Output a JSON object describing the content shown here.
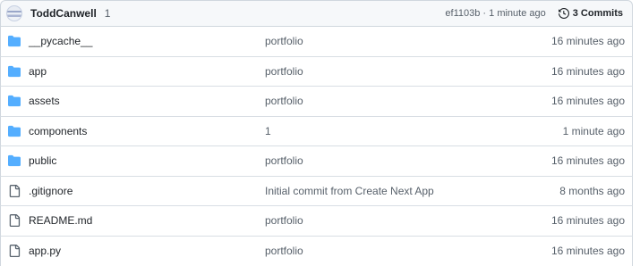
{
  "commit": {
    "author": "ToddCanwell",
    "message": "1",
    "hash": "ef1103b",
    "separator": "·",
    "time": "1 minute ago",
    "meta": "ef1103b · 1 minute ago",
    "history_label": "3 Commits"
  },
  "files": [
    {
      "type": "folder",
      "icon": "folder-icon",
      "name": "__pycache__",
      "message": "portfolio",
      "time": "16 minutes ago"
    },
    {
      "type": "folder",
      "icon": "folder-icon",
      "name": "app",
      "message": "portfolio",
      "time": "16 minutes ago"
    },
    {
      "type": "folder",
      "icon": "folder-icon",
      "name": "assets",
      "message": "portfolio",
      "time": "16 minutes ago"
    },
    {
      "type": "folder",
      "icon": "folder-icon",
      "name": "components",
      "message": "1",
      "time": "1 minute ago"
    },
    {
      "type": "folder",
      "icon": "folder-icon",
      "name": "public",
      "message": "portfolio",
      "time": "16 minutes ago"
    },
    {
      "type": "file",
      "icon": "file-icon",
      "name": ".gitignore",
      "message": "Initial commit from Create Next App",
      "time": "8 months ago"
    },
    {
      "type": "file",
      "icon": "file-icon",
      "name": "README.md",
      "message": "portfolio",
      "time": "16 minutes ago"
    },
    {
      "type": "file",
      "icon": "file-icon",
      "name": "app.py",
      "message": "portfolio",
      "time": "16 minutes ago"
    }
  ],
  "colors": {
    "folder": "#54aeff",
    "file": "#59636e",
    "header_bg": "#f6f8fa",
    "border": "#d0d7de"
  }
}
